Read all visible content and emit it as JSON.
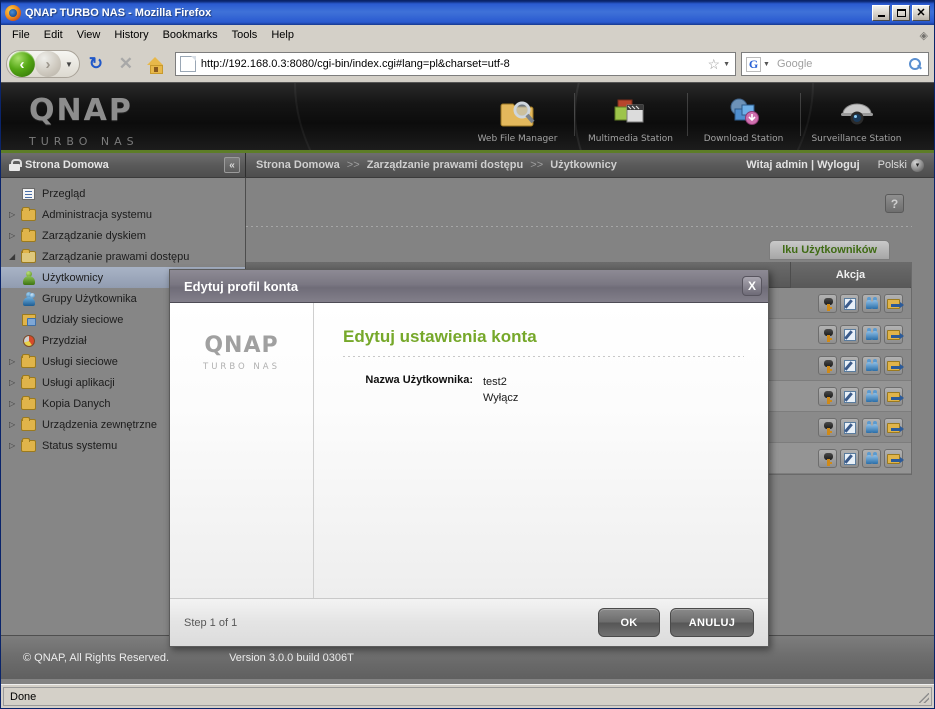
{
  "browser": {
    "window_title": "QNAP TURBO NAS - Mozilla Firefox",
    "window_buttons": {
      "minimize": "_",
      "maximize": "□",
      "close": "✕"
    },
    "menu": [
      {
        "label": "File"
      },
      {
        "label": "Edit"
      },
      {
        "label": "View"
      },
      {
        "label": "History"
      },
      {
        "label": "Bookmarks"
      },
      {
        "label": "Tools"
      },
      {
        "label": "Help"
      }
    ],
    "toolbar": {
      "back_icon": "back-arrow-icon",
      "forward_icon": "forward-arrow-icon",
      "reload_icon": "↻",
      "stop_icon": "✕",
      "home_icon": "home-icon",
      "star_icon": "☆",
      "dropdown_icon": "▾"
    },
    "url": "http://192.168.0.3:8080/cgi-bin/index.cgi#lang=pl&charset=utf-8",
    "search": {
      "engine_letter": "G",
      "placeholder": "Google",
      "magnifier_icon": "search-icon"
    },
    "status": "Done"
  },
  "banner": {
    "brand": "QNAP",
    "brand_sub": "TURBO NAS",
    "apps": [
      {
        "label": "Web File Manager",
        "icon": "folder-magnifier-icon"
      },
      {
        "label": "Multimedia Station",
        "icon": "photo-film-icon"
      },
      {
        "label": "Download Station",
        "icon": "download-monitor-icon"
      },
      {
        "label": "Surveillance Station",
        "icon": "dome-camera-icon"
      }
    ]
  },
  "subnav": {
    "home_label": "Strona Domowa",
    "home_icon": "lock-icon",
    "collapse_icon": "«",
    "breadcrumb": [
      "Strona Domowa",
      "Zarządzanie prawami dostępu",
      "Użytkownicy"
    ],
    "breadcrumb_sep": ">>",
    "greeting": "Witaj admin",
    "greeting_sep": "|",
    "logout": "Wyloguj",
    "language": "Polski",
    "language_caret": "▾"
  },
  "sidebar": {
    "items": [
      {
        "label": "Przegląd",
        "icon": "document-icon",
        "twisty": "",
        "selected": false,
        "indent": 0
      },
      {
        "label": "Administracja systemu",
        "icon": "folder-icon",
        "twisty": "▷",
        "selected": false,
        "indent": 0
      },
      {
        "label": "Zarządzanie dyskiem",
        "icon": "folder-icon",
        "twisty": "▷",
        "selected": false,
        "indent": 0
      },
      {
        "label": "Zarządzanie prawami dostępu",
        "icon": "folder-open-icon",
        "twisty": "◢",
        "selected": false,
        "indent": 0
      },
      {
        "label": "Użytkownicy",
        "icon": "user-icon",
        "twisty": "",
        "selected": true,
        "indent": 1
      },
      {
        "label": "Grupy Użytkownika",
        "icon": "user-group-icon",
        "twisty": "",
        "selected": false,
        "indent": 1
      },
      {
        "label": "Udziały sieciowe",
        "icon": "share-folder-icon",
        "twisty": "",
        "selected": false,
        "indent": 1
      },
      {
        "label": "Przydział",
        "icon": "quota-pie-icon",
        "twisty": "",
        "selected": false,
        "indent": 1
      },
      {
        "label": "Usługi sieciowe",
        "icon": "folder-icon",
        "twisty": "▷",
        "selected": false,
        "indent": 0
      },
      {
        "label": "Usługi aplikacji",
        "icon": "folder-icon",
        "twisty": "▷",
        "selected": false,
        "indent": 0
      },
      {
        "label": "Kopia Danych",
        "icon": "folder-icon",
        "twisty": "▷",
        "selected": false,
        "indent": 0
      },
      {
        "label": "Urządzenia zewnętrzne",
        "icon": "folder-icon",
        "twisty": "▷",
        "selected": false,
        "indent": 0
      },
      {
        "label": "Status systemu",
        "icon": "folder-icon",
        "twisty": "▷",
        "selected": false,
        "indent": 0
      }
    ]
  },
  "main": {
    "help_icon": "?",
    "tab_label": "lku Użytkowników",
    "table": {
      "columns": [
        "Akcja"
      ],
      "rows": [
        {
          "actions": [
            "key-icon",
            "edit-icon",
            "user-group-icon",
            "folder-share-icon"
          ]
        },
        {
          "actions": [
            "key-icon",
            "edit-icon",
            "user-group-icon",
            "folder-share-icon"
          ]
        },
        {
          "actions": [
            "key-icon",
            "edit-icon",
            "user-group-icon",
            "folder-share-icon"
          ]
        },
        {
          "actions": [
            "key-icon",
            "edit-icon",
            "user-group-icon",
            "folder-share-icon"
          ]
        },
        {
          "actions": [
            "key-icon",
            "edit-icon",
            "user-group-icon",
            "folder-share-icon"
          ]
        },
        {
          "actions": [
            "key-icon",
            "edit-icon",
            "user-group-icon",
            "folder-share-icon"
          ]
        }
      ]
    }
  },
  "dialog": {
    "title": "Edytuj profil konta",
    "close_label": "X",
    "logo": "QNAP",
    "logo_sub": "TURBO NAS",
    "heading": "Edytuj ustawienia konta",
    "fields": [
      {
        "label": "Nazwa Użytkownika:",
        "values": [
          "test2",
          "Wyłącz"
        ]
      }
    ],
    "step_text": "Step 1 of 1",
    "ok_label": "OK",
    "cancel_label": "ANULUJ"
  },
  "footer": {
    "copyright": "© QNAP, All Rights Reserved.",
    "version": "Version 3.0.0 build 0306T"
  },
  "colors": {
    "accent_green": "#76a82a",
    "banner_rule": "#5d7d27",
    "title_blue": "#2a5ad0"
  }
}
